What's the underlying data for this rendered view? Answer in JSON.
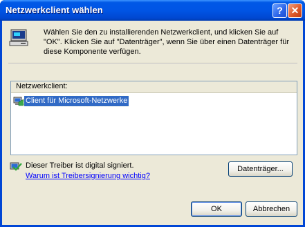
{
  "window": {
    "title": "Netzwerkclient wählen",
    "help_label": "?",
    "close_label": "✕"
  },
  "message": "Wählen Sie den zu installierenden Netzwerkclient, und klicken Sie auf \"OK\". Klicken Sie auf \"Datenträger\", wenn Sie über einen Datenträger für diese Komponente verfügen.",
  "list": {
    "header": "Netzwerkclient:",
    "items": [
      {
        "label": "Client für Microsoft-Netzwerke",
        "selected": true
      }
    ]
  },
  "signature": {
    "text": "Dieser Treiber ist digital signiert.",
    "link": "Warum ist Treibersignierung wichtig?"
  },
  "buttons": {
    "disk": "Datenträger...",
    "ok": "OK",
    "cancel": "Abbrechen"
  },
  "colors": {
    "titlebar": "#0055e5",
    "dialog_bg": "#ece9d8",
    "selection": "#316ac5",
    "link": "#0000ff"
  }
}
